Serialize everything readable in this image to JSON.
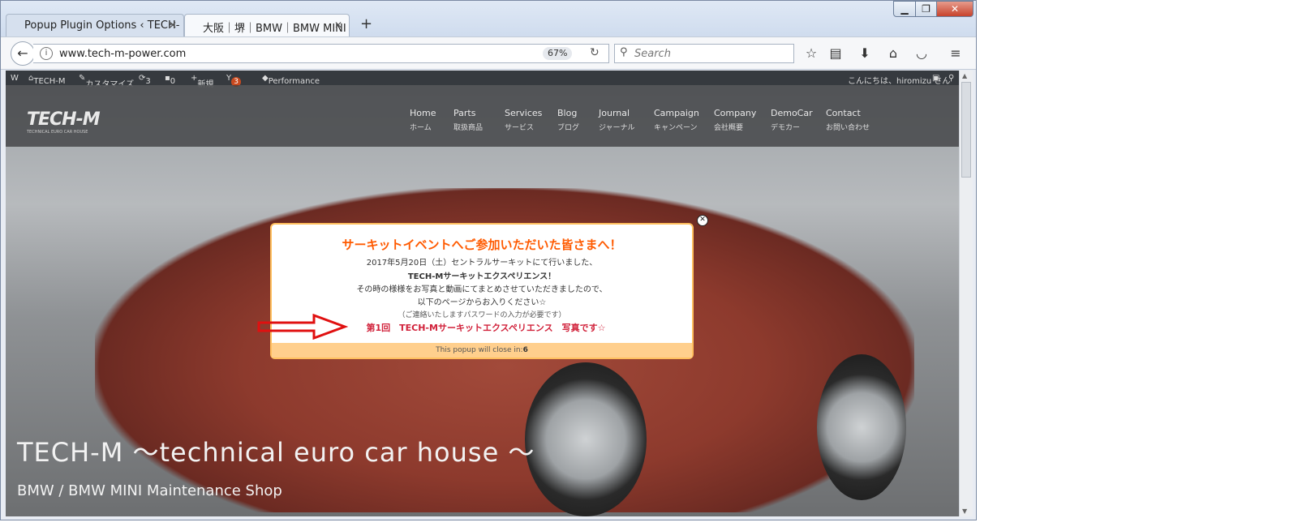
{
  "browser": {
    "tabs": [
      {
        "label": "Popup Plugin Options ‹ TECH-"
      },
      {
        "label": "大阪｜堺｜BMW｜BMW MINI"
      }
    ],
    "url": "www.tech-m-power.com",
    "zoom": "67%",
    "search_placeholder": "Search"
  },
  "adminbar": {
    "wp": "W",
    "site": "TECH-M",
    "customize": "カスタマイズ",
    "updates": "3",
    "comments": "0",
    "new": "新規",
    "seo_badge": "3",
    "performance": "Performance",
    "greeting": "こんにちは、hiromizu さん"
  },
  "site": {
    "logo": "TECH-M",
    "logo_sub": "TECHNICAL EURO CAR HOUSE",
    "menu": [
      {
        "en": "Home",
        "jp": "ホーム"
      },
      {
        "en": "Parts",
        "jp": "取扱商品"
      },
      {
        "en": "Services",
        "jp": "サービス"
      },
      {
        "en": "Blog",
        "jp": "ブログ"
      },
      {
        "en": "Journal",
        "jp": "ジャーナル"
      },
      {
        "en": "Campaign",
        "jp": "キャンペーン"
      },
      {
        "en": "Company",
        "jp": "会社概要"
      },
      {
        "en": "DemoCar",
        "jp": "デモカー"
      },
      {
        "en": "Contact",
        "jp": "お問い合わせ"
      }
    ],
    "hero_title": "TECH-M 〜technical euro car house 〜",
    "hero_subtitle": "BMW / BMW MINI Maintenance Shop"
  },
  "popup": {
    "heading": "サーキットイベントへご参加いただいた皆さまへ！",
    "line1": "2017年5月20日（土）セントラルサーキットにて行いました、",
    "line2": "TECH-Mサーキットエクスペリエンス！",
    "line3": "その時の様様をお写真と動画にてまとめさせていただきましたので、",
    "line4": "以下のページからお入りください☆",
    "line5": "（ご連絡いたしますパスワードの入力が必要です）",
    "link": "第1回　TECH-Mサーキットエクスペリエンス　写真です☆",
    "footer_text": "This popup will close in:",
    "countdown": "6"
  }
}
